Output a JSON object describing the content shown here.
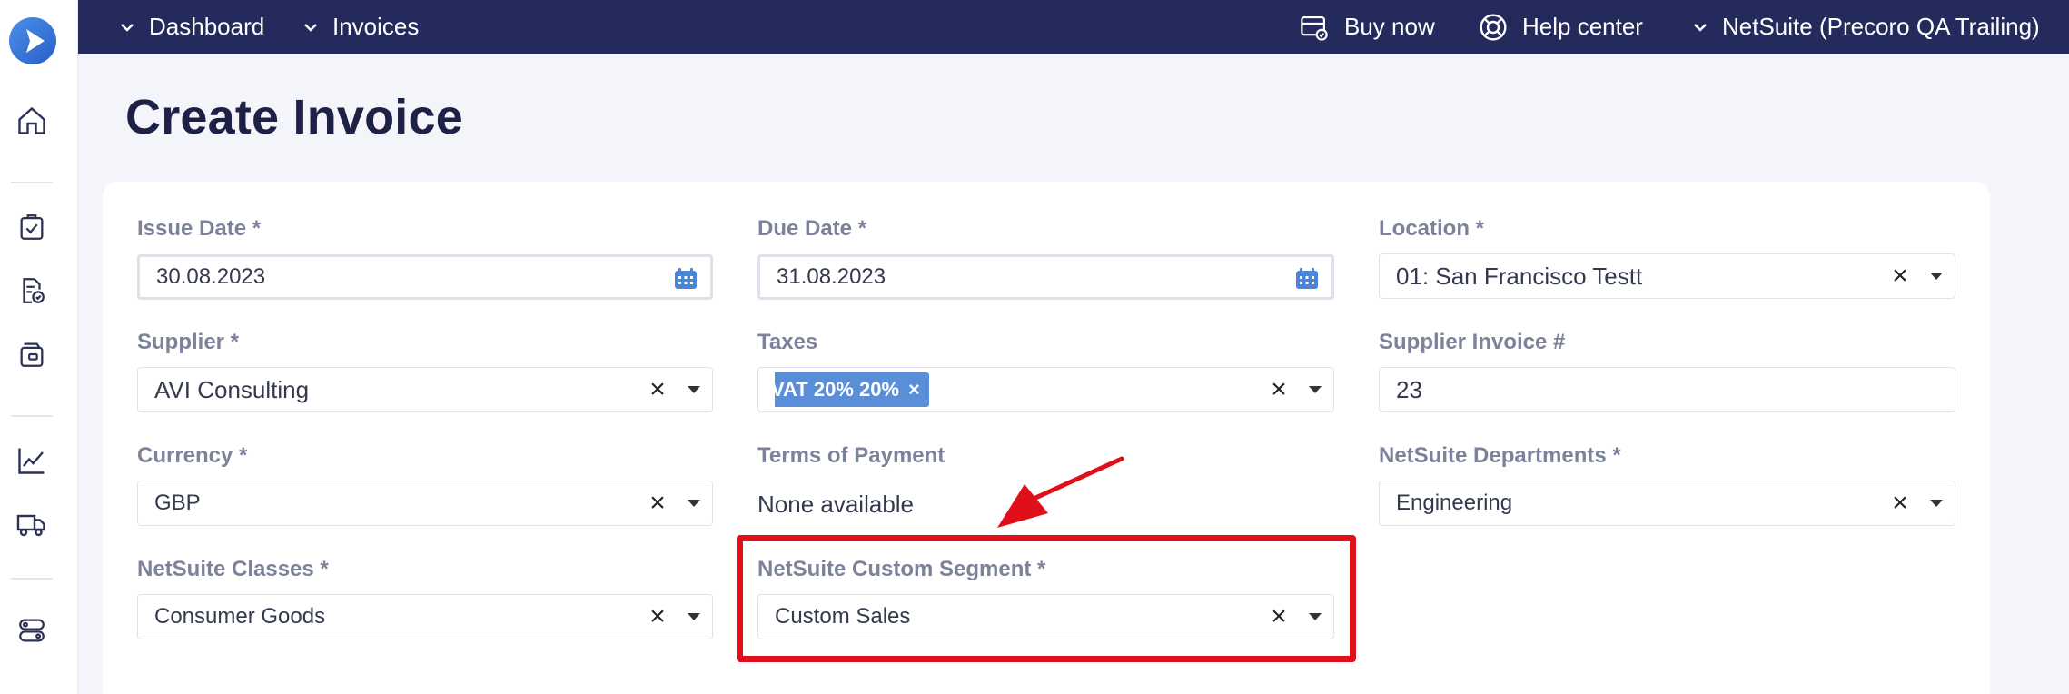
{
  "topbar": {
    "nav": [
      {
        "label": "Dashboard"
      },
      {
        "label": "Invoices"
      }
    ],
    "buy_now": "Buy now",
    "help_center": "Help center",
    "company": "NetSuite (Precoro QA Trailing)"
  },
  "page": {
    "title": "Create Invoice"
  },
  "form": {
    "issue_date": {
      "label": "Issue Date *",
      "value": "30.08.2023"
    },
    "due_date": {
      "label": "Due Date *",
      "value": "31.08.2023"
    },
    "location": {
      "label": "Location *",
      "value": "01: San Francisco Testt"
    },
    "supplier": {
      "label": "Supplier *",
      "value": "AVI Consulting"
    },
    "taxes": {
      "label": "Taxes",
      "tag": "VAT 20% 20%"
    },
    "supplier_invoice": {
      "label": "Supplier Invoice #",
      "value": "23"
    },
    "currency": {
      "label": "Currency *",
      "value": "GBP"
    },
    "terms": {
      "label": "Terms of Payment",
      "value": "None available"
    },
    "departments": {
      "label": "NetSuite Departments *",
      "value": "Engineering"
    },
    "classes": {
      "label": "NetSuite Classes *",
      "value": "Consumer Goods"
    },
    "custom_segment": {
      "label": "NetSuite Custom Segment *",
      "value": "Custom Sales"
    }
  },
  "colors": {
    "topbar": "#242b5c",
    "accent": "#5b8ed8",
    "annotation": "#e0101a"
  }
}
